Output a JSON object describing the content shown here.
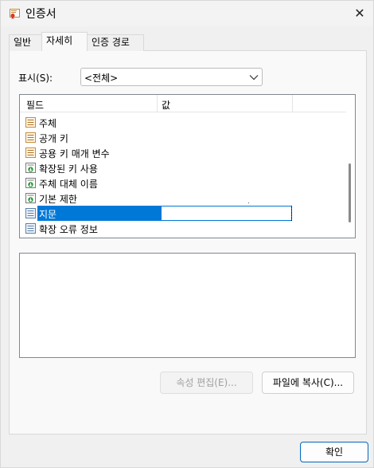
{
  "window": {
    "title": "인증서",
    "close_glyph": "✕",
    "icon": "certificate-icon"
  },
  "tabs": [
    {
      "label": "일반",
      "active": false
    },
    {
      "label": "자세히",
      "active": true
    },
    {
      "label": "인증 경로",
      "active": false
    }
  ],
  "show": {
    "label": "표시(S):",
    "selected": "<전체>",
    "arrow_icon": "chevron-down-icon"
  },
  "list": {
    "headers": {
      "field": "필드",
      "value": "값"
    },
    "rows": [
      {
        "label": "주체",
        "icon": "certificate-field-icon"
      },
      {
        "label": "공개 키",
        "icon": "certificate-field-icon"
      },
      {
        "label": "공용 키 매개 변수",
        "icon": "certificate-field-icon"
      },
      {
        "label": "확장된 키 사용",
        "icon": "extension-icon"
      },
      {
        "label": "주체 대체 이름",
        "icon": "extension-icon"
      },
      {
        "label": "기본 제한",
        "icon": "extension-icon"
      },
      {
        "label": "지문",
        "icon": "property-icon",
        "selected": true
      },
      {
        "label": "확장 오류 정보",
        "icon": "property-icon"
      }
    ]
  },
  "buttons": {
    "edit_properties": "속성 편집(E)...",
    "copy_to_file": "파일에 복사(C)...",
    "ok": "확인"
  },
  "colors": {
    "selection": "#0078d7",
    "primary_border": "#0067c0"
  }
}
